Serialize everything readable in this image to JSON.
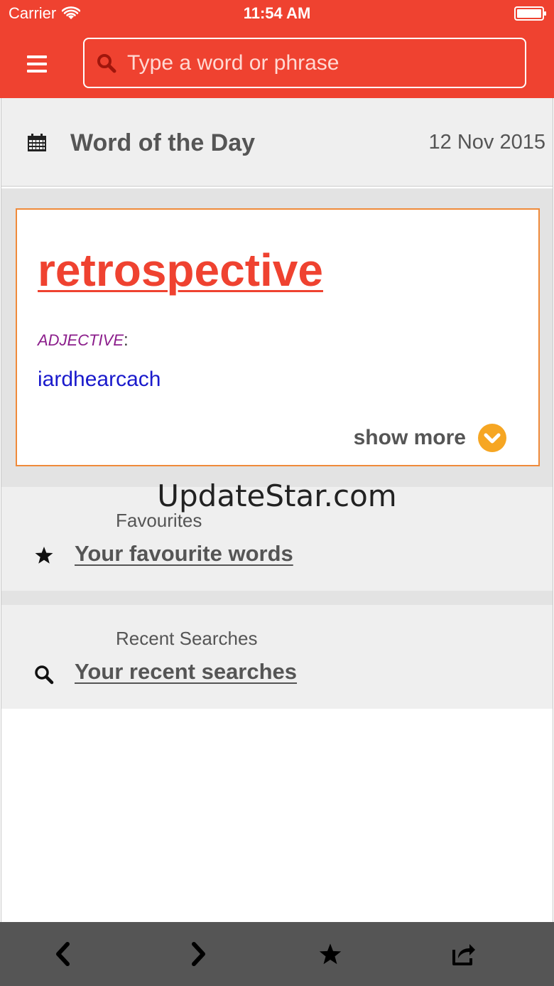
{
  "status_bar": {
    "carrier": "Carrier",
    "time": "11:54 AM"
  },
  "search": {
    "placeholder": "Type a word or phrase",
    "value": ""
  },
  "word_of_the_day": {
    "title": "Word of the Day",
    "date": "12 Nov 2015",
    "word": "retrospective",
    "part_of_speech": "ADJECTIVE",
    "definition": "iardhearcach",
    "show_more_label": "show more"
  },
  "watermark": "UpdateStar.com",
  "favourites": {
    "label": "Favourites",
    "link": "Your favourite words"
  },
  "recent_searches": {
    "label": "Recent Searches",
    "link": "Your recent searches"
  },
  "toolbar": {
    "icons": [
      "back-icon",
      "forward-icon",
      "star-icon",
      "share-icon"
    ]
  },
  "colors": {
    "brand": "#ef4230",
    "card_border": "#ef8a3a",
    "show_more_accent": "#f6a623",
    "part_of_speech": "#8b1d8b",
    "definition": "#1a1acc",
    "toolbar": "#555555"
  }
}
